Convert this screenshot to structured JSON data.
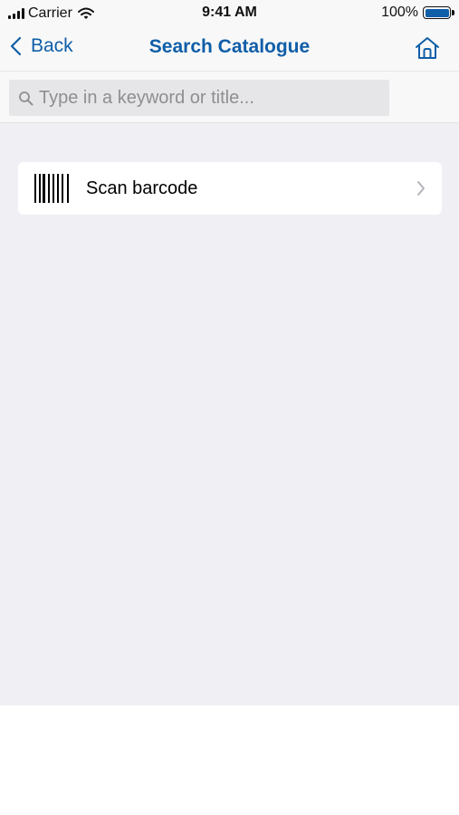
{
  "status_bar": {
    "carrier": "Carrier",
    "time": "9:41 AM",
    "battery_percent": "100%",
    "battery_level": 1.0
  },
  "nav": {
    "back_label": "Back",
    "title": "Search Catalogue",
    "home_icon": "home-icon"
  },
  "search": {
    "placeholder": "Type in a keyword or title...",
    "value": ""
  },
  "scan": {
    "label": "Scan barcode",
    "icon": "barcode-icon"
  },
  "colors": {
    "accent": "#0f5ea8",
    "background": "#efeff4",
    "bar": "#f8f8f8"
  }
}
